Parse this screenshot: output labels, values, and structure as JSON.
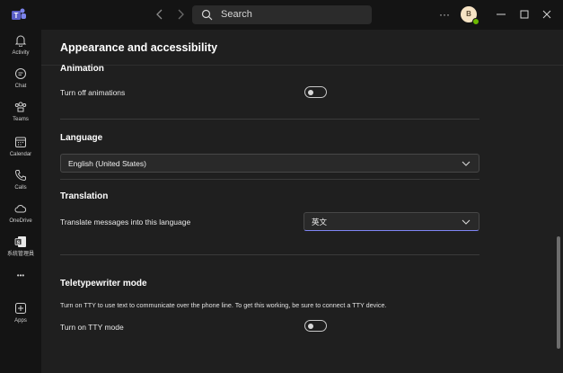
{
  "titlebar": {
    "search_placeholder": "Search",
    "more_label": "···",
    "avatar_initial": "B"
  },
  "rail": {
    "items": [
      {
        "label": "Activity",
        "icon": "bell-icon"
      },
      {
        "label": "Chat",
        "icon": "chat-icon"
      },
      {
        "label": "Teams",
        "icon": "teams-icon"
      },
      {
        "label": "Calendar",
        "icon": "calendar-icon"
      },
      {
        "label": "Calls",
        "icon": "phone-icon"
      },
      {
        "label": "OneDrive",
        "icon": "cloud-icon"
      },
      {
        "label": "系統管理員",
        "icon": "admin-app-icon"
      },
      {
        "label": "•••",
        "icon": "more-apps-icon"
      },
      {
        "label": "Apps",
        "icon": "add-apps-icon"
      }
    ]
  },
  "page": {
    "title": "Appearance and accessibility"
  },
  "animation": {
    "title": "Animation",
    "toggle_label": "Turn off animations",
    "toggle_on": false
  },
  "language": {
    "title": "Language",
    "selected": "English (United States)"
  },
  "translation": {
    "title": "Translation",
    "label": "Translate messages into this language",
    "selected": "英文"
  },
  "tty": {
    "title": "Teletypewriter mode",
    "description": "Turn on TTY to use text to communicate over the phone line. To get this working, be sure to connect a TTY device.",
    "toggle_label": "Turn on TTY mode",
    "toggle_on": false
  },
  "colors": {
    "background": "#1f1f1f",
    "rail": "#141414",
    "accent": "#7f85f5",
    "presence": "#6bb700"
  }
}
